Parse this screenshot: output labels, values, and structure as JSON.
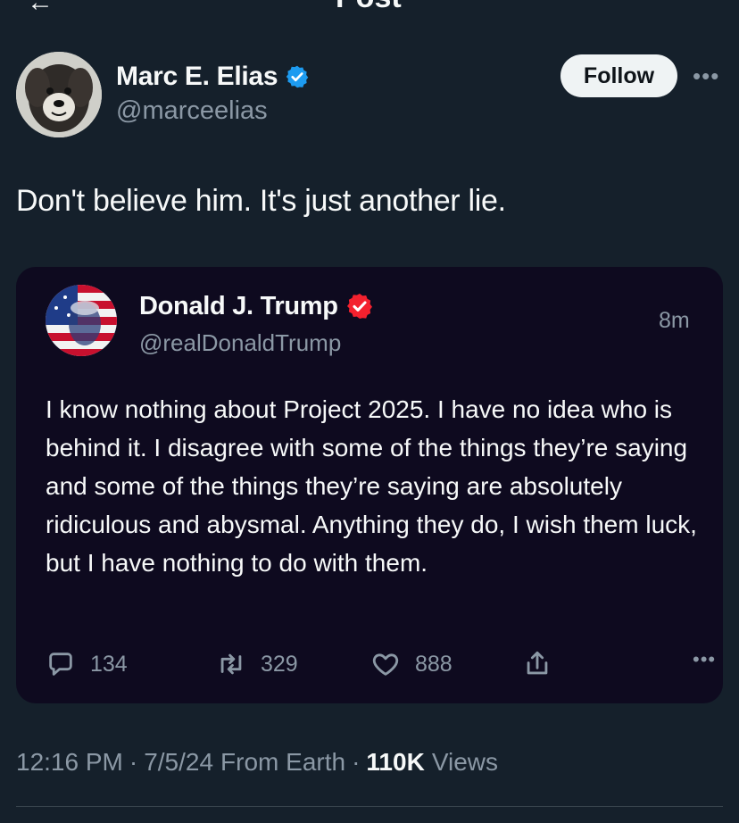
{
  "header": {
    "title": "Post",
    "back_icon": "arrow-left-icon"
  },
  "author": {
    "name": "Marc E. Elias",
    "handle": "@marceelias",
    "verified_color": "#1d9bf0",
    "avatar": "dog-photo"
  },
  "follow_label": "Follow",
  "post_text": "Don't believe him. It's just another lie.",
  "quoted": {
    "name": "Donald J. Trump",
    "handle": "@realDonaldTrump",
    "verified_color": "#f4212e",
    "time": "8m",
    "avatar": "flag-portrait",
    "text": "I know nothing about Project 2025. I have no idea who is behind it. I disagree with some of the things they’re saying and some of the things they’re saying are absolutely ridiculous and abysmal. Anything they do, I wish them luck, but I have nothing to do with them.",
    "replies": "134",
    "reposts": "329",
    "likes": "888"
  },
  "meta": {
    "time": "12:16 PM",
    "date": "7/5/24",
    "location": "From Earth",
    "views_count": "110K",
    "views_label": "Views"
  },
  "colors": {
    "background": "#15202b",
    "card": "#0e0a1f",
    "muted": "#8b98a5",
    "text": "#f7f9f9"
  }
}
